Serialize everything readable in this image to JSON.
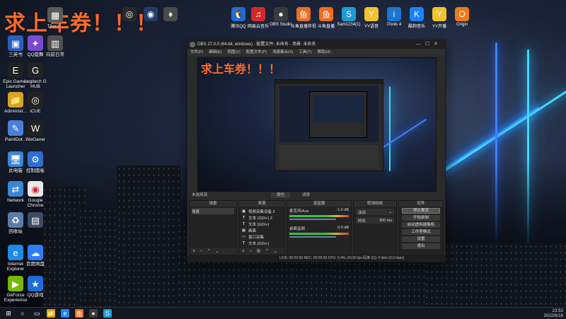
{
  "overlay": {
    "title": "求上车券！！！"
  },
  "top_icons": [
    {
      "label": "",
      "icon": "app-icon",
      "color": "#2a2a2a"
    },
    {
      "label": "",
      "icon": "app-icon",
      "color": "#233c6a"
    },
    {
      "label": "",
      "icon": "app-icon",
      "color": "#4a4a4a"
    },
    {
      "label": "腾讯QQ",
      "icon": "qq-icon",
      "color": "#1f6bd8"
    },
    {
      "label": "网易云音乐",
      "icon": "music-icon",
      "color": "#d12a2a"
    },
    {
      "label": "OBS Studio",
      "icon": "obs-icon",
      "color": "#3b3b3b"
    },
    {
      "label": "斗鱼直播伴侣",
      "icon": "douyu-icon",
      "color": "#f06b22"
    },
    {
      "label": "斗鱼直播",
      "icon": "douyu-icon",
      "color": "#f06b22"
    },
    {
      "label": "Sam1234(1)",
      "icon": "s-icon",
      "color": "#1e9bd7"
    },
    {
      "label": "YY语音",
      "icon": "yy-icon",
      "color": "#f2c12e"
    },
    {
      "label": "iTools 4",
      "icon": "itools-icon",
      "color": "#1976d2"
    },
    {
      "label": "酷狗音乐",
      "icon": "kugou-icon",
      "color": "#1b82ff"
    },
    {
      "label": "YY开播",
      "icon": "yy-open-icon",
      "color": "#f2c12e"
    },
    {
      "label": "Origin",
      "icon": "origin-icon",
      "color": "#f07a1a"
    }
  ],
  "desktop_icons_col1": [
    {
      "label": "三英书",
      "icon": "app-icon",
      "color": "#2b5fbf"
    },
    {
      "label": "Epic Games Launcher",
      "icon": "epic-icon",
      "color": "#222"
    },
    {
      "label": "Administr...",
      "icon": "folder-icon",
      "color": "#d6a324"
    },
    {
      "label": "PaintDot...",
      "icon": "paint-icon",
      "color": "#4a7fd6"
    },
    {
      "label": "此电脑",
      "icon": "computer-icon",
      "color": "#3a87d6"
    },
    {
      "label": "Network",
      "icon": "network-icon",
      "color": "#3a87d6"
    },
    {
      "label": "回收站",
      "icon": "recycle-icon",
      "color": "#5c7ba7"
    },
    {
      "label": "Internet Explorer",
      "icon": "ie-icon",
      "color": "#1d8be0"
    },
    {
      "label": "GeForce Experience",
      "icon": "geforce-icon",
      "color": "#76b900"
    }
  ],
  "desktop_icons_col2": [
    {
      "label": "QQ旋舞",
      "icon": "app-icon",
      "color": "#7a4bd0"
    },
    {
      "label": "Logitech G HUB",
      "icon": "logitech-icon",
      "color": "#222"
    },
    {
      "label": "iCUE",
      "icon": "icue-icon",
      "color": "#222"
    },
    {
      "label": "WeGame",
      "icon": "wegame-icon",
      "color": "#222"
    },
    {
      "label": "控制面板",
      "icon": "control-panel-icon",
      "color": "#2f6ed0"
    },
    {
      "label": "Google Chrome",
      "icon": "chrome-icon",
      "color": "#e9e9e9"
    },
    {
      "label": "",
      "icon": "app-icon",
      "color": "#3b4b63"
    },
    {
      "label": "百度网盘",
      "icon": "baidu-icon",
      "color": "#2e7df6"
    },
    {
      "label": "QQ游戏",
      "icon": "qqgame-icon",
      "color": "#1f6bd8"
    }
  ],
  "desktop_icons_col3": [
    {
      "label": "Thera...",
      "icon": "app-icon",
      "color": "#5a5a5a"
    },
    {
      "label": "向前日常",
      "icon": "app-icon",
      "color": "#505050"
    }
  ],
  "obs": {
    "title": "OBS 27.0.0 (64-bit, windows) - 配置文件: 未命名 - 场景: 未命名",
    "menu": [
      "文件(F)",
      "编辑(E)",
      "视图(V)",
      "配置文件(P)",
      "场景集合(S)",
      "工具(T)",
      "帮助(H)"
    ],
    "dock_tabs": {
      "left": "未选择源",
      "tab1": "属性",
      "tab2": "滤镜"
    },
    "scenes": {
      "header": "场景",
      "items": [
        "场景"
      ]
    },
    "sources": {
      "header": "来源",
      "items": [
        "视频采集设备 2",
        "文本 (GDI+) 2",
        "文本 (GDI+)",
        "画面",
        "窗口采集",
        "文本 (GDI+)"
      ]
    },
    "mixer": {
      "header": "混音器",
      "tracks": [
        {
          "name": "麦克风/Aux",
          "level": "-1.0 dB"
        },
        {
          "name": "桌面音频",
          "level": "0.0 dB"
        }
      ]
    },
    "transitions": {
      "header": "转场特效",
      "effect": "淡出",
      "duration_label": "时长",
      "duration": "300 ms"
    },
    "controls": {
      "header": "控件",
      "buttons": [
        "停止推流",
        "开始录制",
        "启动虚拟摄像机",
        "工作室模式",
        "设置",
        "退出"
      ]
    },
    "status": "LIVE: 00:00:00   REC: 00:00:00   CPU: 0.4%, 60.00 fps   码率 (Q): 0 kb/s  (0.0 kbps)"
  },
  "taskbar": {
    "time": "23:53",
    "date": "2022/6/18"
  }
}
